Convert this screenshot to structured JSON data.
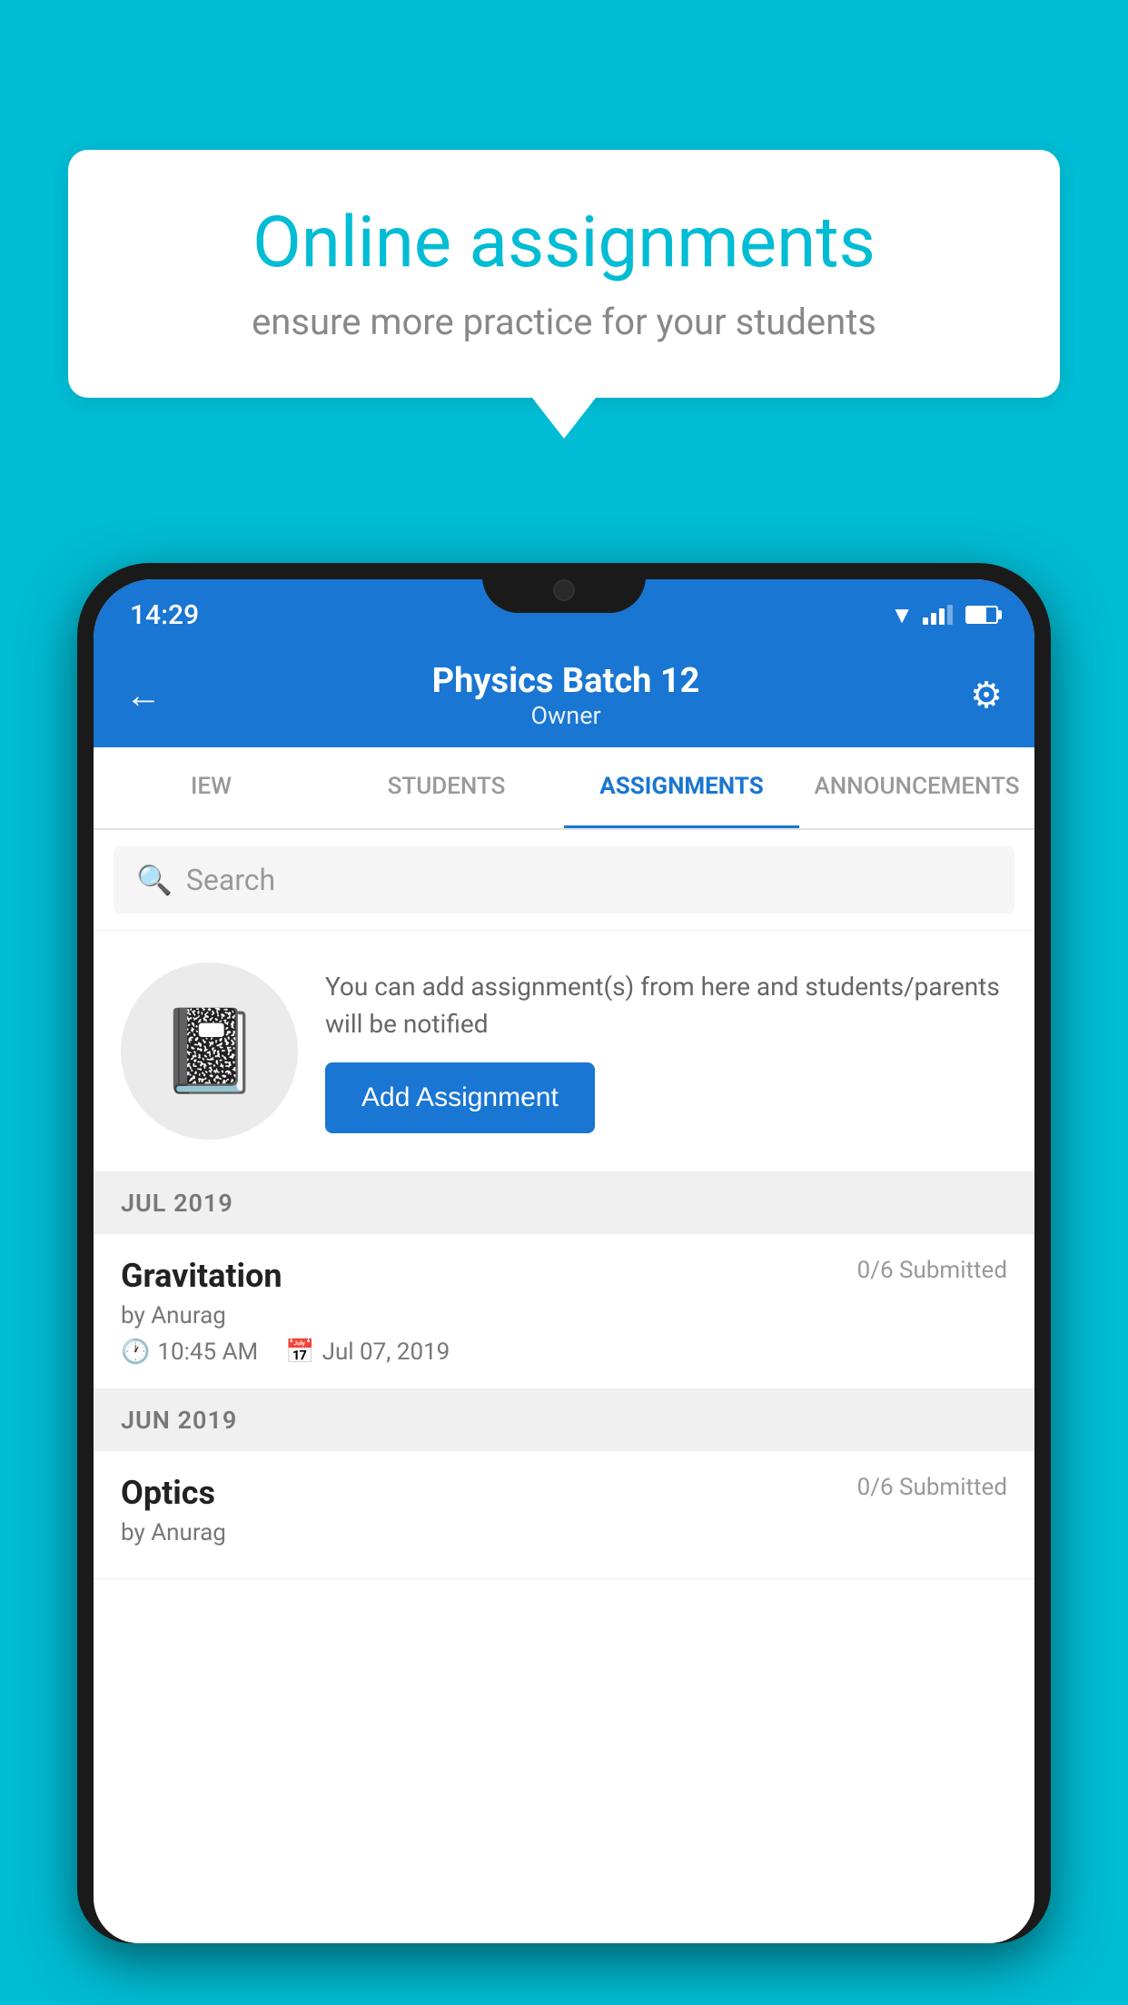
{
  "background_color": "#00bcd4",
  "speech_bubble": {
    "title": "Online assignments",
    "subtitle": "ensure more practice for your students"
  },
  "status_bar": {
    "time": "14:29"
  },
  "header": {
    "title": "Physics Batch 12",
    "subtitle": "Owner",
    "back_label": "←",
    "settings_label": "⚙"
  },
  "tabs": [
    {
      "label": "IEW",
      "active": false
    },
    {
      "label": "STUDENTS",
      "active": false
    },
    {
      "label": "ASSIGNMENTS",
      "active": true
    },
    {
      "label": "ANNOUNCEMENTS",
      "active": false
    }
  ],
  "search": {
    "placeholder": "Search"
  },
  "add_assignment": {
    "description": "You can add assignment(s) from here and students/parents will be notified",
    "button_label": "Add Assignment"
  },
  "sections": [
    {
      "header": "JUL 2019",
      "assignments": [
        {
          "name": "Gravitation",
          "submitted": "0/6 Submitted",
          "author": "by Anurag",
          "time": "10:45 AM",
          "date": "Jul 07, 2019"
        }
      ]
    },
    {
      "header": "JUN 2019",
      "assignments": [
        {
          "name": "Optics",
          "submitted": "0/6 Submitted",
          "author": "by Anurag",
          "time": "",
          "date": ""
        }
      ]
    }
  ]
}
